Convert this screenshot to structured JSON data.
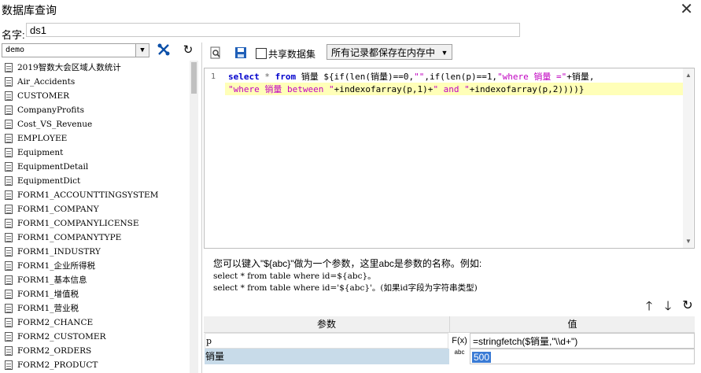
{
  "window": {
    "title": "数据库查询",
    "close_glyph": "✕"
  },
  "name_row": {
    "label": "名字:",
    "value": "ds1"
  },
  "left": {
    "datasource": "demo",
    "tables": [
      "2019智数大会区域人数统计",
      "Air_Accidents",
      "CUSTOMER",
      "CompanyProfits",
      "Cost_VS_Revenue",
      "EMPLOYEE",
      "Equipment",
      "EquipmentDetail",
      "EquipmentDict",
      "FORM1_ACCOUNTTINGSYSTEM",
      "FORM1_COMPANY",
      "FORM1_COMPANYLICENSE",
      "FORM1_COMPANYTYPE",
      "FORM1_INDUSTRY",
      "FORM1_企业所得税",
      "FORM1_基本信息",
      "FORM1_增值税",
      "FORM1_营业税",
      "FORM2_CHANCE",
      "FORM2_CUSTOMER",
      "FORM2_ORDERS",
      "FORM2_PRODUCT"
    ]
  },
  "toolbar": {
    "share_label": "共享数据集",
    "mode_value": "所有记录都保存在内存中"
  },
  "editor": {
    "line_number": "1",
    "line1": {
      "t1": "select",
      "t2": " * ",
      "t3": "from",
      "t4": " 销量 ${if(len(销量)==0,",
      "t5": "\"\"",
      "t6": ",if(len(p)==1,",
      "t7": "\"where 销量 =\"",
      "t8": "+销量,"
    },
    "line2": {
      "t1": "\"where 销量 between \"",
      "t2": "+indexofarray(p,1)+",
      "t3": "\" and \"",
      "t4": "+indexofarray(p,2))))}"
    }
  },
  "hint": {
    "line1": "您可以键入\"${abc}\"做为一个参数，这里abc是参数的名称。例如:",
    "line2": "select * from table where id=${abc}。",
    "line3": "select * from table where id='${abc}'。(如果id字段为字符串类型)"
  },
  "params": {
    "header_name": "参数",
    "header_value": "值",
    "rows": [
      {
        "name": "p",
        "type_icon": "F(x)",
        "value": "=stringfetch($销量,\"\\\\d+\")"
      },
      {
        "name": "销量",
        "type_icon": "abc",
        "value": "500"
      }
    ]
  },
  "icons": {
    "refresh": "↻",
    "arrow_up": "🡑",
    "arrow_down": "🡓"
  }
}
